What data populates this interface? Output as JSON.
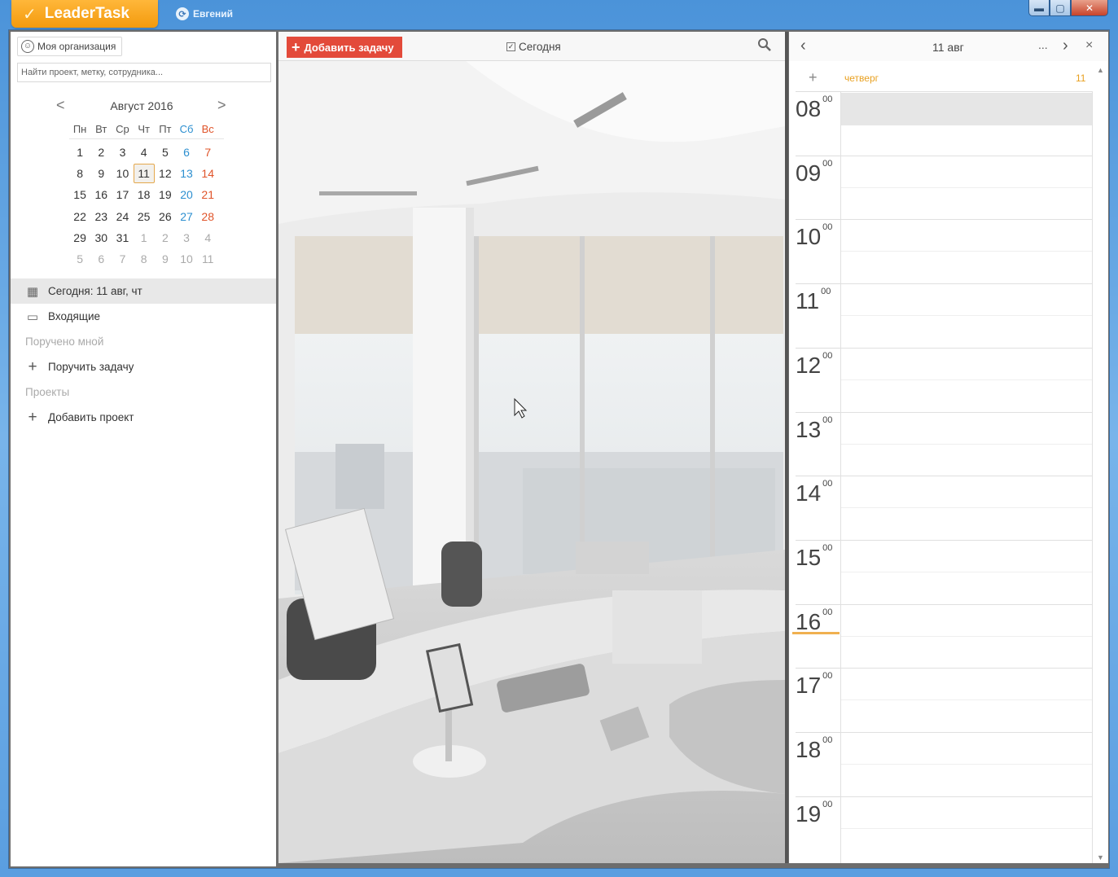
{
  "window": {
    "app_name": "LeaderTask",
    "user_name": "Евгений",
    "controls": {
      "minimize": "▬",
      "maximize": "▢",
      "close": "✕"
    }
  },
  "left_panel": {
    "org_button": "Моя организация",
    "search_placeholder": "Найти проект, метку, сотрудника...",
    "calendar": {
      "month_title": "Август 2016",
      "prev": "<",
      "next": ">",
      "weekdays": [
        "Пн",
        "Вт",
        "Ср",
        "Чт",
        "Пт",
        "Сб",
        "Вс"
      ],
      "weeks": [
        [
          "1",
          "2",
          "3",
          "4",
          "5",
          "6",
          "7"
        ],
        [
          "8",
          "9",
          "10",
          "11",
          "12",
          "13",
          "14"
        ],
        [
          "15",
          "16",
          "17",
          "18",
          "19",
          "20",
          "21"
        ],
        [
          "22",
          "23",
          "24",
          "25",
          "26",
          "27",
          "28"
        ],
        [
          "29",
          "30",
          "31",
          "1",
          "2",
          "3",
          "4"
        ],
        [
          "5",
          "6",
          "7",
          "8",
          "9",
          "10",
          "11"
        ]
      ],
      "selected_day": "11"
    },
    "nav": {
      "today": "Сегодня: 11 авг, чт",
      "inbox": "Входящие",
      "delegated_section": "Поручено мной",
      "delegate_task": "Поручить задачу",
      "projects_section": "Проекты",
      "add_project": "Добавить проект"
    }
  },
  "middle_panel": {
    "add_task_label": "Добавить задачу",
    "today_filter_label": "Сегодня"
  },
  "right_panel": {
    "date_label": "11 авг",
    "more_label": "...",
    "close_label": "×",
    "day_name": "четверг",
    "day_number": "11",
    "add_label": "+",
    "hours": [
      "08",
      "09",
      "10",
      "11",
      "12",
      "13",
      "14",
      "15",
      "16",
      "17",
      "18",
      "19"
    ],
    "minutes_label": "00"
  },
  "colors": {
    "accent_orange": "#f39a0d",
    "add_task_red": "#e34a3a",
    "saturday_blue": "#2c8fd0",
    "sunday_red": "#e0542a"
  }
}
